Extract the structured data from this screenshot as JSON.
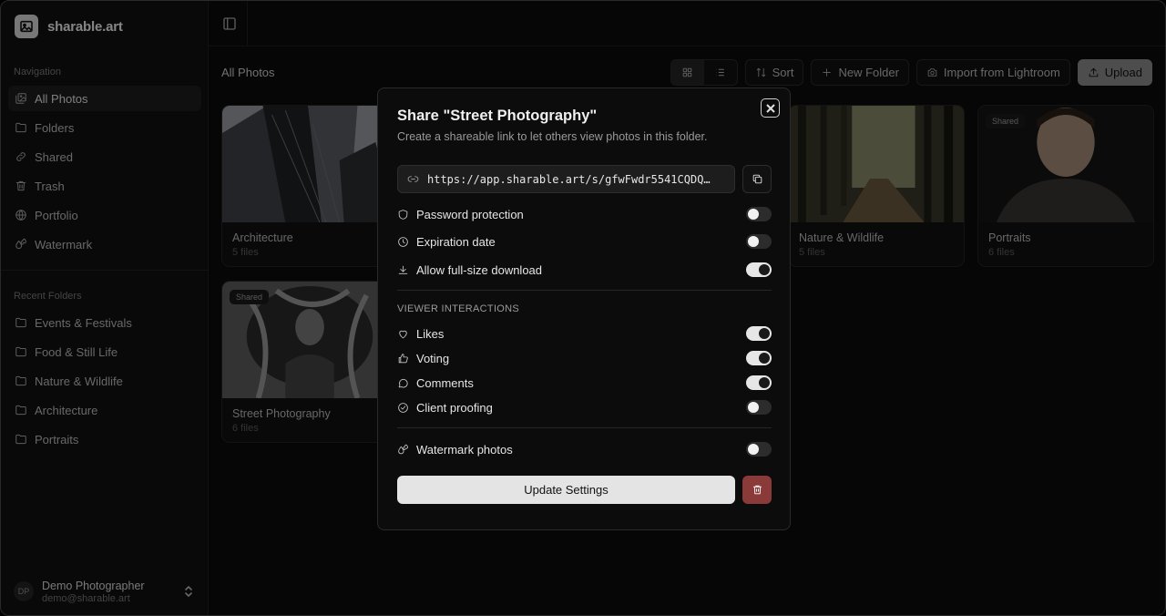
{
  "app": {
    "name": "sharable.art"
  },
  "sidebar": {
    "nav_label": "Navigation",
    "items": [
      {
        "label": "All Photos",
        "icon": "images-icon"
      },
      {
        "label": "Folders",
        "icon": "folder-icon"
      },
      {
        "label": "Shared",
        "icon": "link-icon"
      },
      {
        "label": "Trash",
        "icon": "trash-icon"
      },
      {
        "label": "Portfolio",
        "icon": "globe-icon"
      },
      {
        "label": "Watermark",
        "icon": "droplets-icon"
      }
    ],
    "recent_label": "Recent Folders",
    "recent": [
      {
        "label": "Events & Festivals"
      },
      {
        "label": "Food & Still Life"
      },
      {
        "label": "Nature & Wildlife"
      },
      {
        "label": "Architecture"
      },
      {
        "label": "Portraits"
      }
    ],
    "user": {
      "initials": "DP",
      "name": "Demo Photographer",
      "email": "demo@sharable.art"
    }
  },
  "main": {
    "breadcrumb": "All Photos",
    "toolbar": {
      "sort": "Sort",
      "new_folder": "New Folder",
      "import": "Import from Lightroom",
      "upload": "Upload"
    },
    "folders": [
      {
        "title": "Architecture",
        "count": "5 files",
        "badge": ""
      },
      {
        "title": "Nature & Wildlife",
        "count": "5 files",
        "badge": ""
      },
      {
        "title": "Portraits",
        "count": "6 files",
        "badge": "Shared"
      },
      {
        "title": "Street Photography",
        "count": "6 files",
        "badge": "Shared"
      }
    ]
  },
  "modal": {
    "title": "Share \"Street Photography\"",
    "subtitle": "Create a shareable link to let others view photos in this folder.",
    "url": "https://app.sharable.art/s/gfwFwdr5541CQDQ…",
    "settings": [
      {
        "label": "Password protection",
        "on": false
      },
      {
        "label": "Expiration date",
        "on": false
      },
      {
        "label": "Allow full-size download",
        "on": true
      }
    ],
    "viewer_label": "VIEWER INTERACTIONS",
    "viewer": [
      {
        "label": "Likes",
        "on": true
      },
      {
        "label": "Voting",
        "on": true
      },
      {
        "label": "Comments",
        "on": true
      },
      {
        "label": "Client proofing",
        "on": false
      }
    ],
    "watermark": {
      "label": "Watermark photos",
      "on": false
    },
    "update_label": "Update Settings"
  }
}
